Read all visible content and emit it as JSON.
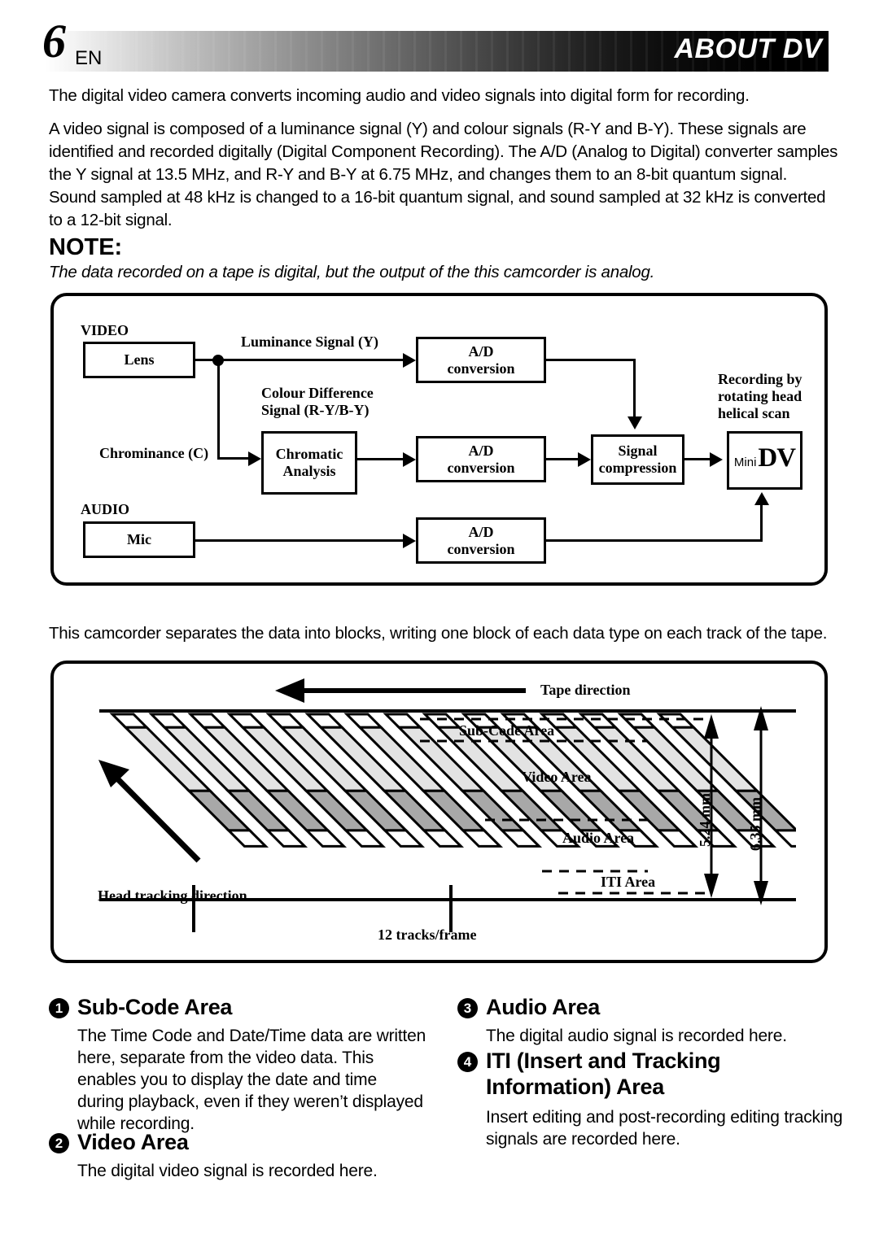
{
  "header": {
    "page_number": "6",
    "language": "EN",
    "title": "ABOUT DV"
  },
  "intro": {
    "p1": "The digital video camera converts incoming audio and video signals into digital form for recording.",
    "p2": "A video signal is composed of a luminance signal (Y) and colour signals (R-Y and B-Y). These signals are identified and recorded digitally (Digital Component Recording). The A/D (Analog to Digital) converter samples the Y signal at 13.5 MHz, and R-Y and B-Y at 6.75 MHz, and changes them to an 8-bit quantum signal.",
    "p3": "Sound sampled at 48 kHz is changed to a 16-bit quantum signal, and sound sampled at 32 kHz is converted to a 12-bit signal."
  },
  "note": {
    "heading": "NOTE:",
    "text": "The data recorded on a tape is digital, but the output of the this camcorder is analog."
  },
  "block_diagram": {
    "section_video": "VIDEO",
    "section_audio": "AUDIO",
    "lens": "Lens",
    "luminance_label": "Luminance Signal (Y)",
    "colour_difference_label_line1": "Colour Difference",
    "colour_difference_label_line2": "Signal (R-Y/B-Y)",
    "chrominance_label": "Chrominance (C)",
    "chromatic_line1": "Chromatic",
    "chromatic_line2": "Analysis",
    "mic": "Mic",
    "ad_line1": "A/D",
    "ad_line2": "conversion",
    "signal_compression_line1": "Signal",
    "signal_compression_line2": "compression",
    "recording_line1": "Recording by",
    "recording_line2": "rotating head",
    "recording_line3": "helical scan",
    "mini_label": "Mini",
    "dv_label": "DV"
  },
  "mid_text": "This camcorder separates the data into blocks, writing one block of each data type on each track of the tape.",
  "tape_diagram": {
    "tape_direction": "Tape direction",
    "head_tracking_direction": "Head tracking direction",
    "sub_code_area": "Sub-Code Area",
    "video_area": "Video Area",
    "audio_area": "Audio Area",
    "iti_area": "ITI Area",
    "dim_inner": "5.24 mm",
    "dim_outer": "6.35 mm",
    "tracks_per_frame": "12 tracks/frame",
    "track_count": 12,
    "colors": {
      "video_band": "#e3e3e3",
      "audio_band": "#a8a8a8",
      "subcode_band": "#ffffff",
      "iti_band": "#ffffff"
    }
  },
  "sections": [
    {
      "number": "❶",
      "title": "Sub-Code Area",
      "body": "The Time Code and Date/Time data are written here, separate from the video data. This enables you to display the date and time during playback, even if they weren’t displayed while recording."
    },
    {
      "number": "❷",
      "title": "Video Area",
      "body": "The digital video signal is recorded here."
    },
    {
      "number": "❸",
      "title": "Audio Area",
      "body": "The digital audio signal is recorded here."
    },
    {
      "number": "❹",
      "title": "ITI (Insert and Tracking Information) Area",
      "body": "Insert editing and post-recording editing tracking signals are recorded here."
    }
  ]
}
